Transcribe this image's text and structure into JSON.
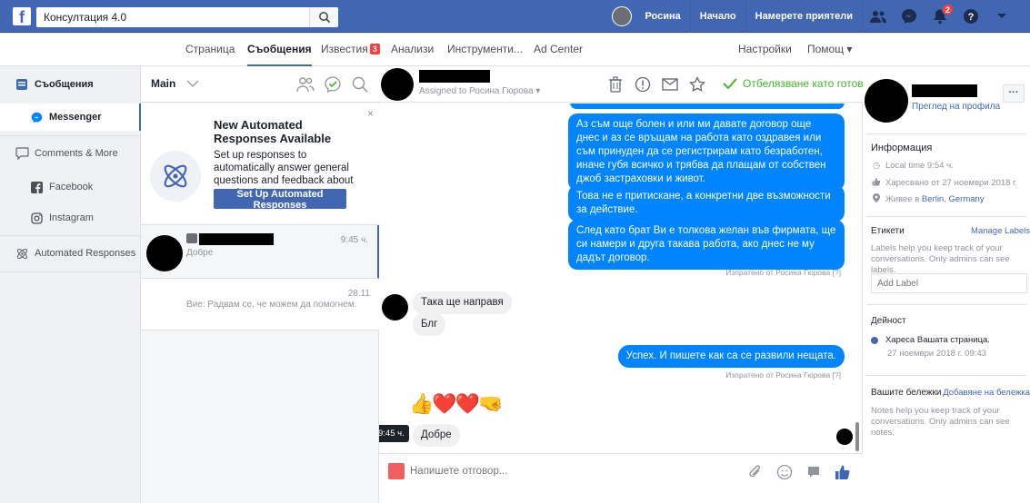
{
  "topbar": {
    "logo": "f",
    "search_value": "Консултация 4.0",
    "profile_name": "Росина",
    "home": "Начало",
    "find_friends": "Намерете приятели",
    "notification_count": "2",
    "icons": [
      "friends-icon",
      "messenger-icon",
      "notifications-icon",
      "help-icon",
      "account-menu-icon"
    ]
  },
  "page_tabs": {
    "page": "Страница",
    "messages": "Съобщения",
    "notifications": "Известия",
    "notifications_badge": "3",
    "insights": "Анализи",
    "tools": "Инструменти...",
    "ad_center": "Ad Center",
    "settings": "Настройки",
    "help": "Помощ ▾"
  },
  "leftnav": {
    "inbox": "Съобщения",
    "messenger": "Messenger",
    "comments": "Comments & More",
    "facebook": "Facebook",
    "instagram": "Instagram",
    "automated": "Automated Responses"
  },
  "convlist": {
    "filter": "Main",
    "promo_title": "New Automated Responses Available",
    "promo_text": "Set up responses to automatically answer general questions and feedback about your business.",
    "promo_button": "Set Up Automated Responses",
    "promo_close": "×",
    "conversations": [
      {
        "preview": "Добре",
        "time": "9:45 ч."
      },
      {
        "preview": "Вие: Радвам се, че можем да помогнем.",
        "time": "28.11"
      }
    ]
  },
  "chat": {
    "assigned": "Assigned to Росина Гюрова ▾",
    "mark_done": "Отбелязване като готово",
    "messages_out": [
      "Аз съм още болен и или ми давате договор още днес и аз се връщам на работа като оздравея или съм принуден да се регистрирам като безработен, иначе губя всичко и трябва да плащам от собствен джоб застраховки и живот.",
      "Това не е притискане, а конкретни две възможности за действие.",
      "След като брат Ви е толкова желан във фирмата, ще си намери и друга такава работа, ако днес не му дадът договор."
    ],
    "sent_note_1": "Изпратено от Росина Гюрова [?]",
    "in_1": "Така ще направя",
    "in_2": "Блг",
    "out_reply": "Успех. И пишете как са се развили нещата.",
    "sent_note_2": "Изпратено от Росина Гюрова [?]",
    "emoji": "👍❤️❤️🤜",
    "time_tip": "9:45 ч.",
    "in_3": "Добре",
    "composer_placeholder": "Напишете отговор..."
  },
  "rpanel": {
    "view_profile": "Преглед на профила",
    "more": "···",
    "info_title": "Информация",
    "local_time": "Local time 9:54 ч.",
    "liked": "Харесвано от 27 ноември 2018 г.",
    "lives_prefix": "Живее в",
    "city": "Berlin",
    "country": "Germany",
    "labels_title": "Етикети",
    "manage_labels": "Manage Labels",
    "labels_help": "Labels help you keep track of your conversations. Only admins can see labels.",
    "add_label_placeholder": "Add Label",
    "activity_title": "Дейност",
    "activity_text": "Хареса Вашата страница.",
    "activity_date": "27 ноември 2018 г. 09:43",
    "notes_title": "Вашите бележки",
    "add_note": "Добавяне на бележка",
    "notes_help": "Notes help you keep track of your conversations. Only admins can see notes."
  },
  "colors": {
    "brand": "#4267b2",
    "bubble": "#0084ff",
    "done": "#42b72a",
    "badge": "#fa3e3e"
  }
}
